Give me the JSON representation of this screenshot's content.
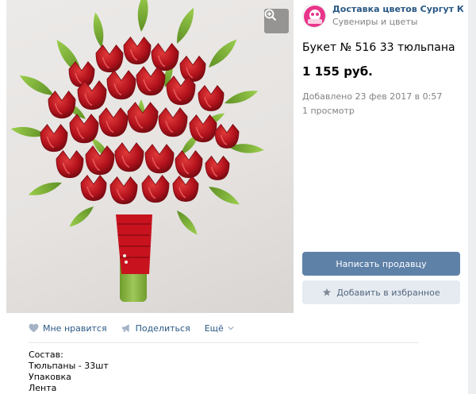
{
  "shop": {
    "name": "Доставка цветов Сургут Кемер...",
    "category": "Сувениры и цветы",
    "avatar_colors": {
      "ring": "#e8358a",
      "inner": "#ffffff"
    }
  },
  "product": {
    "title": "Букет № 516 33 тюльпана",
    "price": "1 155 руб.",
    "added": "Добавлено 23 фев 2017 в 0:57",
    "views": "1 просмотр"
  },
  "buttons": {
    "contact_seller": "Написать продавцу",
    "add_favorite": "Добавить в избранное"
  },
  "actions": {
    "like": "Мне нравится",
    "share": "Поделиться",
    "more": "Ещё"
  },
  "description": {
    "lines": [
      "Состав:",
      "Тюльпаны - 33шт",
      "Упаковка",
      "Лента"
    ]
  },
  "icons": {
    "zoom": "zoom-in-icon",
    "like": "heart-icon",
    "share": "share-megaphone-icon",
    "more": "chevron-down-icon",
    "favorite": "star-icon"
  },
  "colors": {
    "link": "#2a5885",
    "primary_button": "#5e81a8",
    "secondary_button": "#e5ebf1",
    "muted_text": "#828282",
    "tulip_red": "#b3121c",
    "leaf_green": "#7fb13a"
  }
}
